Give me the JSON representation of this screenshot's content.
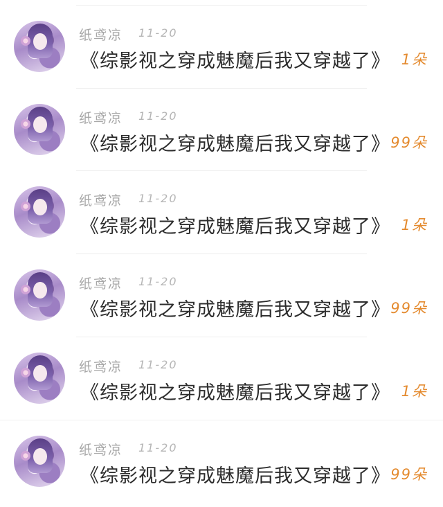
{
  "items": [
    {
      "name": "纸鸢凉",
      "date": "11-20",
      "title": "《综影视之穿成魅魔后我又穿越了》",
      "count": "1朵"
    },
    {
      "name": "纸鸢凉",
      "date": "11-20",
      "title": "《综影视之穿成魅魔后我又穿越了》",
      "count": "99朵"
    },
    {
      "name": "纸鸢凉",
      "date": "11-20",
      "title": "《综影视之穿成魅魔后我又穿越了》",
      "count": "1朵"
    },
    {
      "name": "纸鸢凉",
      "date": "11-20",
      "title": "《综影视之穿成魅魔后我又穿越了》",
      "count": "99朵"
    },
    {
      "name": "纸鸢凉",
      "date": "11-20",
      "title": "《综影视之穿成魅魔后我又穿越了》",
      "count": "1朵"
    },
    {
      "name": "纸鸢凉",
      "date": "11-20",
      "title": "《综影视之穿成魅魔后我又穿越了》",
      "count": "99朵"
    }
  ],
  "colors": {
    "name": "#a7a7a7",
    "date": "#b5b5b5",
    "title": "#2c2c2c",
    "count": "#e48a2e",
    "divider": "#eeeeee"
  }
}
